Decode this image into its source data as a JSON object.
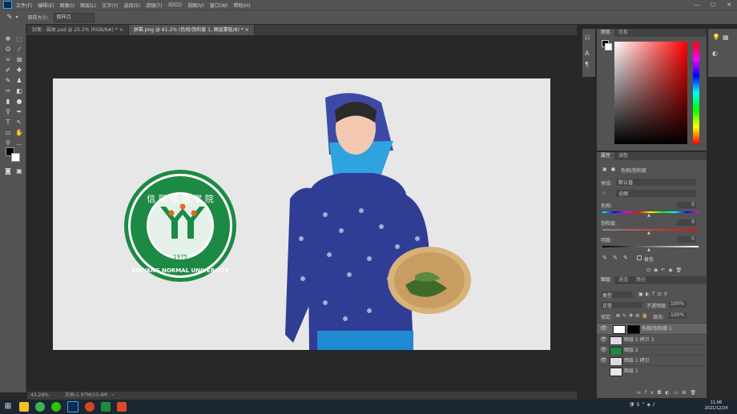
{
  "app": {
    "menu": [
      "文件(F)",
      "编辑(E)",
      "图像(I)",
      "图层(L)",
      "文字(Y)",
      "选择(S)",
      "滤镜(T)",
      "3D(D)",
      "视图(V)",
      "窗口(W)",
      "帮助(H)"
    ],
    "window_controls": [
      "—",
      "☐",
      "✕"
    ]
  },
  "options_bar": {
    "sample_label": "取样大小:",
    "sample_value": "取样点"
  },
  "tabs": [
    {
      "label": "封面 - 副本.psd @ 25.2% (RGB/8#) *",
      "close": "×"
    },
    {
      "label": "屏幕.png @ 61.2% (色相/饱和度 1, 图层蒙版/8) *",
      "close": "×"
    }
  ],
  "canvas": {
    "logo": {
      "chars": "信 阳 师 范 学 院",
      "year": "1975",
      "english": "XINYANG NORMAL UNIVERSITY"
    }
  },
  "status": {
    "zoom": "43.28%",
    "doc": "文档:1.97M/10.4M"
  },
  "color_panel": {
    "tabs": [
      "颜色",
      "色板"
    ]
  },
  "properties": {
    "tabs": [
      "属性",
      "调整"
    ],
    "title": "色相/饱和度",
    "preset_label": "预设:",
    "preset_value": "默认值",
    "channel_value": "全图",
    "hue_label": "色相:",
    "hue_value": "0",
    "sat_label": "饱和度:",
    "sat_value": "0",
    "light_label": "明度:",
    "light_value": "0",
    "colorize": "着色"
  },
  "layers_panel": {
    "tabs": [
      "图层",
      "通道",
      "路径"
    ],
    "kind": "类型",
    "blend": "正常",
    "opacity_label": "不透明度:",
    "opacity_value": "100%",
    "lock_label": "锁定:",
    "fill_label": "填充:",
    "fill_value": "100%",
    "layers": [
      {
        "name": "色相/饱和度 1",
        "selected": true
      },
      {
        "name": "图层 1 拷贝 3",
        "selected": false
      },
      {
        "name": "图层 2",
        "selected": false
      },
      {
        "name": "图层 1 拷贝",
        "selected": false
      },
      {
        "name": "图层 1",
        "selected": false
      }
    ]
  },
  "clock": {
    "time": "11:06",
    "date": "2021/12/24"
  },
  "colors": {
    "accent": "#31a8ff",
    "logo_green": "#1c8a44",
    "panel": "#535353",
    "canvas_bg": "#e7e7e7"
  }
}
